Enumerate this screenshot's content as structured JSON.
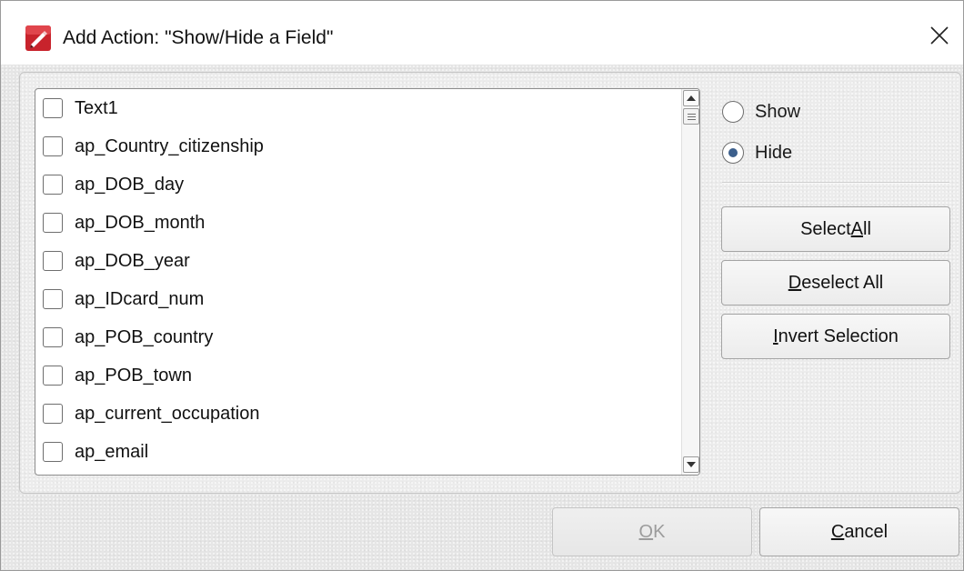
{
  "window": {
    "title": "Add Action: \"Show/Hide a Field\"",
    "app_icon": "pdf-editor-icon",
    "close_icon": "close-icon"
  },
  "fields": {
    "items": [
      {
        "label": "Text1",
        "checked": false
      },
      {
        "label": "ap_Country_citizenship",
        "checked": false
      },
      {
        "label": "ap_DOB_day",
        "checked": false
      },
      {
        "label": "ap_DOB_month",
        "checked": false
      },
      {
        "label": "ap_DOB_year",
        "checked": false
      },
      {
        "label": "ap_IDcard_num",
        "checked": false
      },
      {
        "label": "ap_POB_country",
        "checked": false
      },
      {
        "label": "ap_POB_town",
        "checked": false
      },
      {
        "label": "ap_current_occupation",
        "checked": false
      },
      {
        "label": "ap_email",
        "checked": false
      }
    ]
  },
  "visibility": {
    "show_label": "Show",
    "hide_label": "Hide",
    "selected": "Hide"
  },
  "selection_buttons": {
    "select_all": {
      "pre": "Select ",
      "acc": "A",
      "post": "ll"
    },
    "deselect_all": {
      "pre": "",
      "acc": "D",
      "post": "eselect All"
    },
    "invert_selection": {
      "pre": "",
      "acc": "I",
      "post": "nvert Selection"
    }
  },
  "footer": {
    "ok": {
      "pre": "",
      "acc": "O",
      "post": "K",
      "enabled": false
    },
    "cancel": {
      "pre": "",
      "acc": "C",
      "post": "ancel",
      "enabled": true
    }
  },
  "colors": {
    "radio_dot": "#3c5f8c",
    "icon_red": "#c8232c"
  }
}
